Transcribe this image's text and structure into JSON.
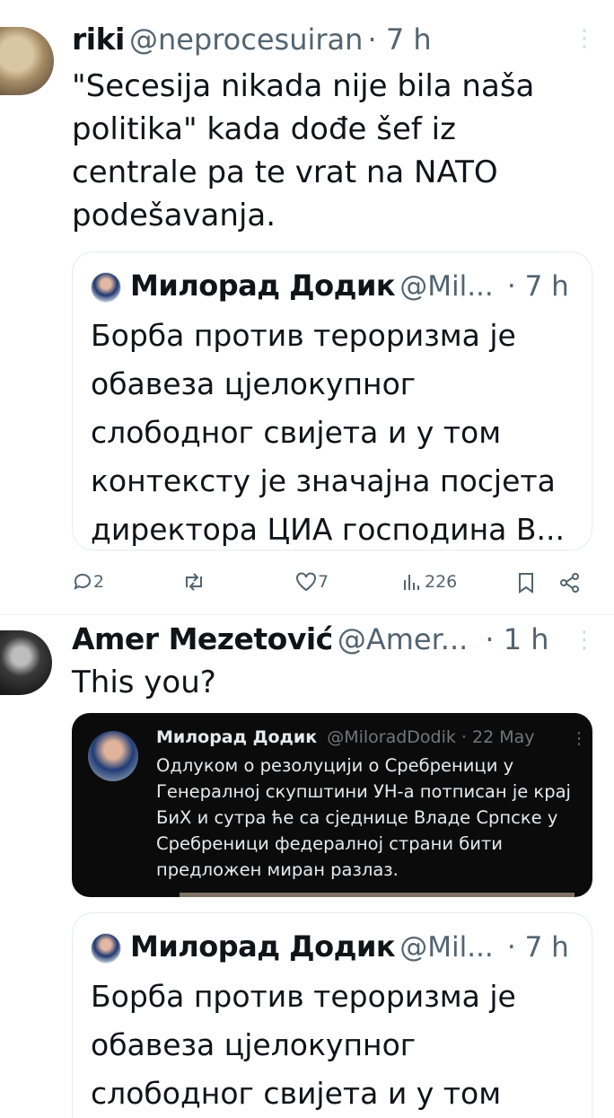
{
  "tweet1": {
    "name": "riki",
    "handle": "@neprocesuiran",
    "time": "· 7 h",
    "lines": [
      "\"Secesija nikada nije bila naša",
      "politika\" kada dođe šef iz",
      "centrale pa te vrat na NATO",
      "podešavanja."
    ],
    "quote": {
      "name": "Милорад Додик",
      "handle": "@Mil...",
      "time": "· 7 h",
      "lines": [
        "Борба против тероризма је",
        "обавеза цјелокупног",
        "слободног свијета и у том",
        "контексту је значајна посјета",
        "директора ЦИА господина В..."
      ]
    },
    "actions": {
      "replies": "2",
      "likes": "7",
      "views": "226"
    }
  },
  "tweet2": {
    "name": "Amer Mezetović",
    "handle": "@Amer...",
    "time": "· 1 h",
    "text": "This you?",
    "image": {
      "name": "Милорад Додик",
      "meta": "@MiloradDodik · 22 May",
      "lines": [
        "Одлуком о резолуцији о Сребреници у",
        "Генералној скупштини УН-а потписан је крај",
        "БиХ и сутра ће са сједнице Владе Српске у",
        "Сребреници федералној страни бити",
        "предложен миран разлаз."
      ]
    },
    "quote": {
      "name": "Милорад Додик",
      "handle": "@Mil...",
      "time": "· 7 h",
      "lines": [
        "Борба против тероризма је",
        "обавеза цјелокупног",
        "слободног свијета и у том"
      ]
    }
  }
}
